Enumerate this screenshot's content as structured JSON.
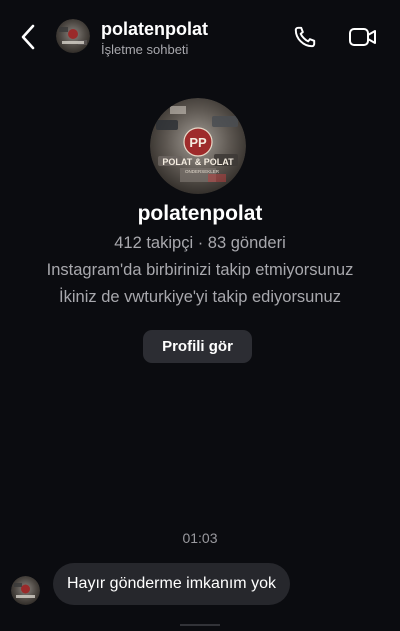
{
  "header": {
    "name": "polatenpolat",
    "subtitle": "İşletme sohbeti",
    "back_icon": "chevron-left-icon",
    "call_icon": "phone-icon",
    "video_icon": "video-camera-icon"
  },
  "avatar_logo": {
    "initials": "PP",
    "brand_text": "POLAT & POLAT",
    "tagline": "ONDERSEKLER"
  },
  "profile": {
    "name": "polatenpolat",
    "stats": "412 takipçi · 83 gönderi",
    "follow_status": "Instagram'da birbirinizi takip etmiyorsunuz",
    "mutual": "İkiniz de vwturkiye'yi takip ediyorsunuz",
    "view_profile_label": "Profili gör"
  },
  "thread": {
    "timestamp": "01:03",
    "messages": [
      {
        "text": "Hayır gönderme imkanım yok"
      }
    ]
  },
  "colors": {
    "background": "#0b0c10",
    "bubble": "#26272c",
    "button": "#2c2d33",
    "secondary_text": "#a8a8ad"
  }
}
